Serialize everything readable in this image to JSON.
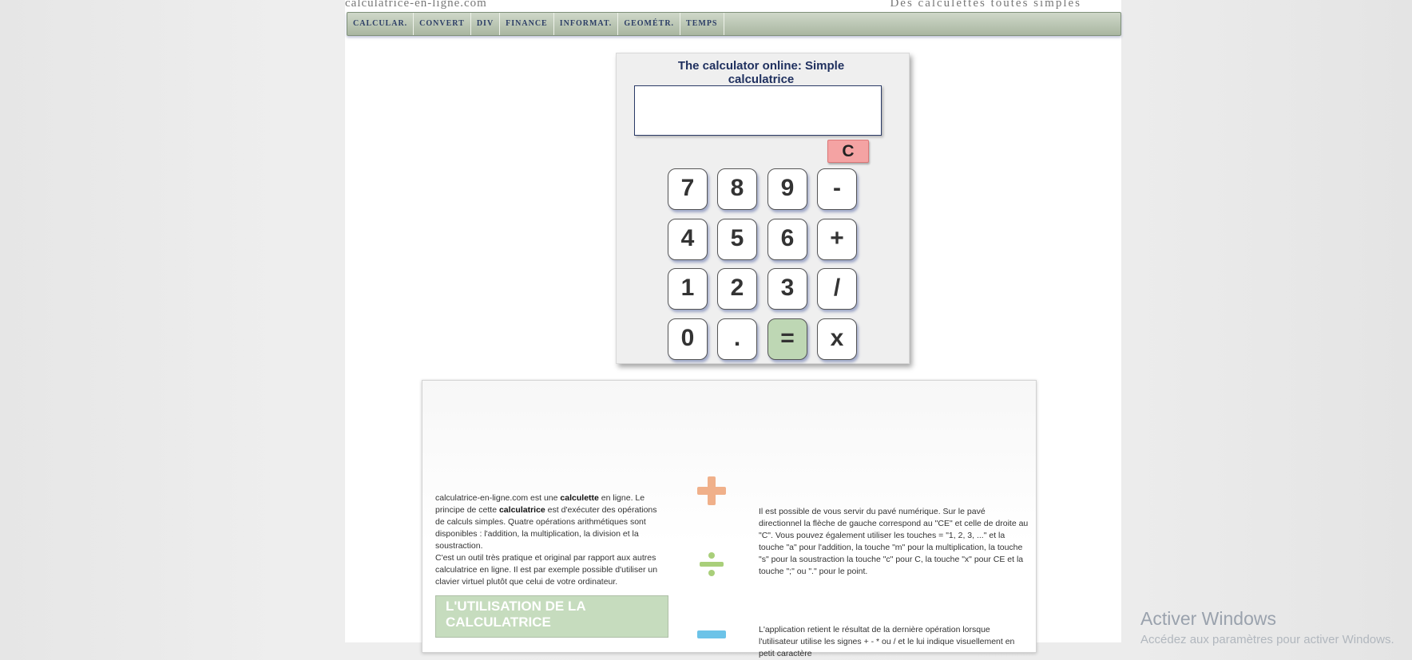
{
  "site": {
    "domain": "calculatrice-en-ligne.com",
    "tagline": "Des calculettes toutes simples"
  },
  "menu": {
    "items": [
      "CALCULAR.",
      "CONVERT",
      "DIV",
      "FINANCE",
      "INFORMAT.",
      "GEOMÉTR.",
      "TEMPS"
    ]
  },
  "calculator": {
    "title": "The calculator online: Simple calculatrice",
    "display_value": "",
    "clear_label": "C",
    "keys": {
      "k7": "7",
      "k8": "8",
      "k9": "9",
      "kminus": "-",
      "k4": "4",
      "k5": "5",
      "k6": "6",
      "kplus": "+",
      "k1": "1",
      "k2": "2",
      "k3": "3",
      "kdiv": "/",
      "k0": "0",
      "kdot": ".",
      "keq": "=",
      "kmul": "x"
    }
  },
  "info": {
    "left_intro": "calculatrice-en-ligne.com est une ",
    "left_bold1": "calculette",
    "left_mid1": " en ligne. Le principe de cette ",
    "left_bold2": "calculatrice",
    "left_rest": " est d'exécuter des opérations de calculs simples. Quatre opérations arithmétiques sont disponibles : l'addition, la multiplication, la division et la soustraction.",
    "left_p2": "C'est un outil très pratique et original par rapport aux autres calculatrice en ligne. Il est par exemple possible d'utiliser un clavier virtuel plutôt que celui de votre ordinateur.",
    "usage_heading": "L'UTILISATION DE LA CALCULATRICE",
    "right_p1": "Il est possible de vous servir du pavé numérique. Sur le pavé directionnel la flèche de gauche correspond au \"CE\" et celle de droite au \"C\". Vous pouvez également utiliser les touches = \"1, 2, 3, ...\" et la touche \"a\" pour l'addition, la touche \"m\" pour la multiplication, la touche \"s\" pour la soustraction la touche \"c\" pour C, la touche \"x\" pour CE et la touche \";\" ou \".\" pour le point.",
    "right_p2": "L'application retient le résultat de la dernière opération lorsque l'utilisateur utilise les signes + - * ou / et le lui indique visuellement en petit caractère"
  },
  "colors": {
    "plus": "#f0b08a",
    "divide": "#a9cf7a",
    "minus": "#6cc3e8"
  },
  "os_watermark": {
    "title": "Activer Windows",
    "subtitle": "Accédez aux paramètres pour activer Windows."
  }
}
